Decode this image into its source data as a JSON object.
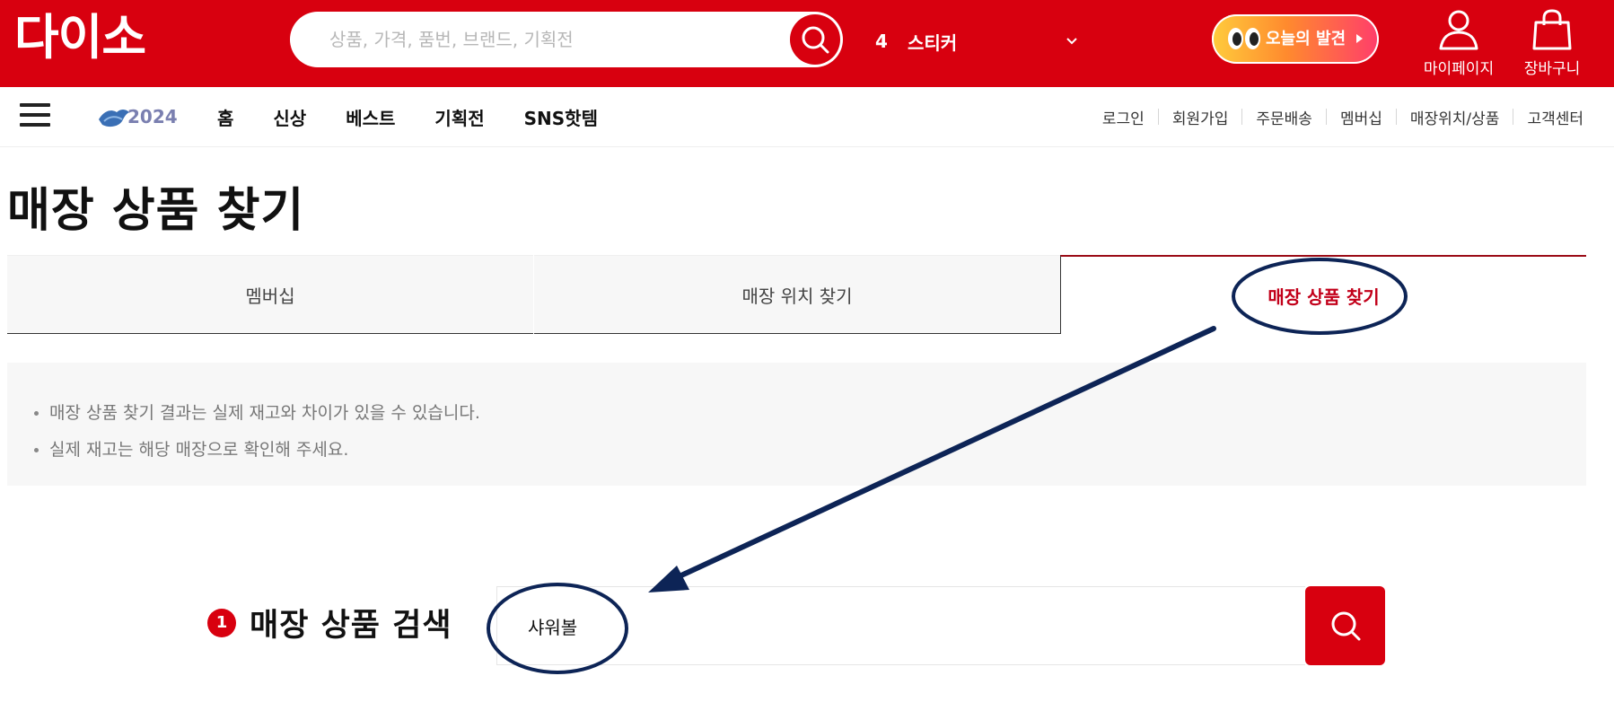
{
  "header": {
    "logo": "다이소",
    "search_placeholder": "상품, 가격, 품번, 브랜드, 기획전",
    "trend_rank": "4",
    "trend_word": "스티커",
    "discover_label": "오늘의 발견",
    "mypage_label": "마이페이지",
    "cart_label": "장바구니",
    "brand_color": "#d8000f"
  },
  "nav": {
    "main": [
      "홈",
      "신상",
      "베스트",
      "기획전",
      "SNS핫템"
    ],
    "sub": [
      "로그인",
      "회원가입",
      "주문배송",
      "멤버십",
      "매장위치/상품",
      "고객센터"
    ],
    "badge": "2024"
  },
  "page": {
    "title": "매장 상품 찾기",
    "tabs": [
      {
        "label": "멤버십",
        "active": false
      },
      {
        "label": "매장 위치 찾기",
        "active": false
      },
      {
        "label": "매장 상품 찾기",
        "active": true
      }
    ],
    "notices": [
      "매장 상품 찾기 결과는 실제 재고와 차이가 있을 수 있습니다.",
      "실제 재고는 해당 매장으로 확인해 주세요."
    ],
    "step_number": "1",
    "step_title": "매장 상품 검색",
    "search_value": "샤워볼"
  },
  "annotation": {
    "color": "#0d2456"
  }
}
